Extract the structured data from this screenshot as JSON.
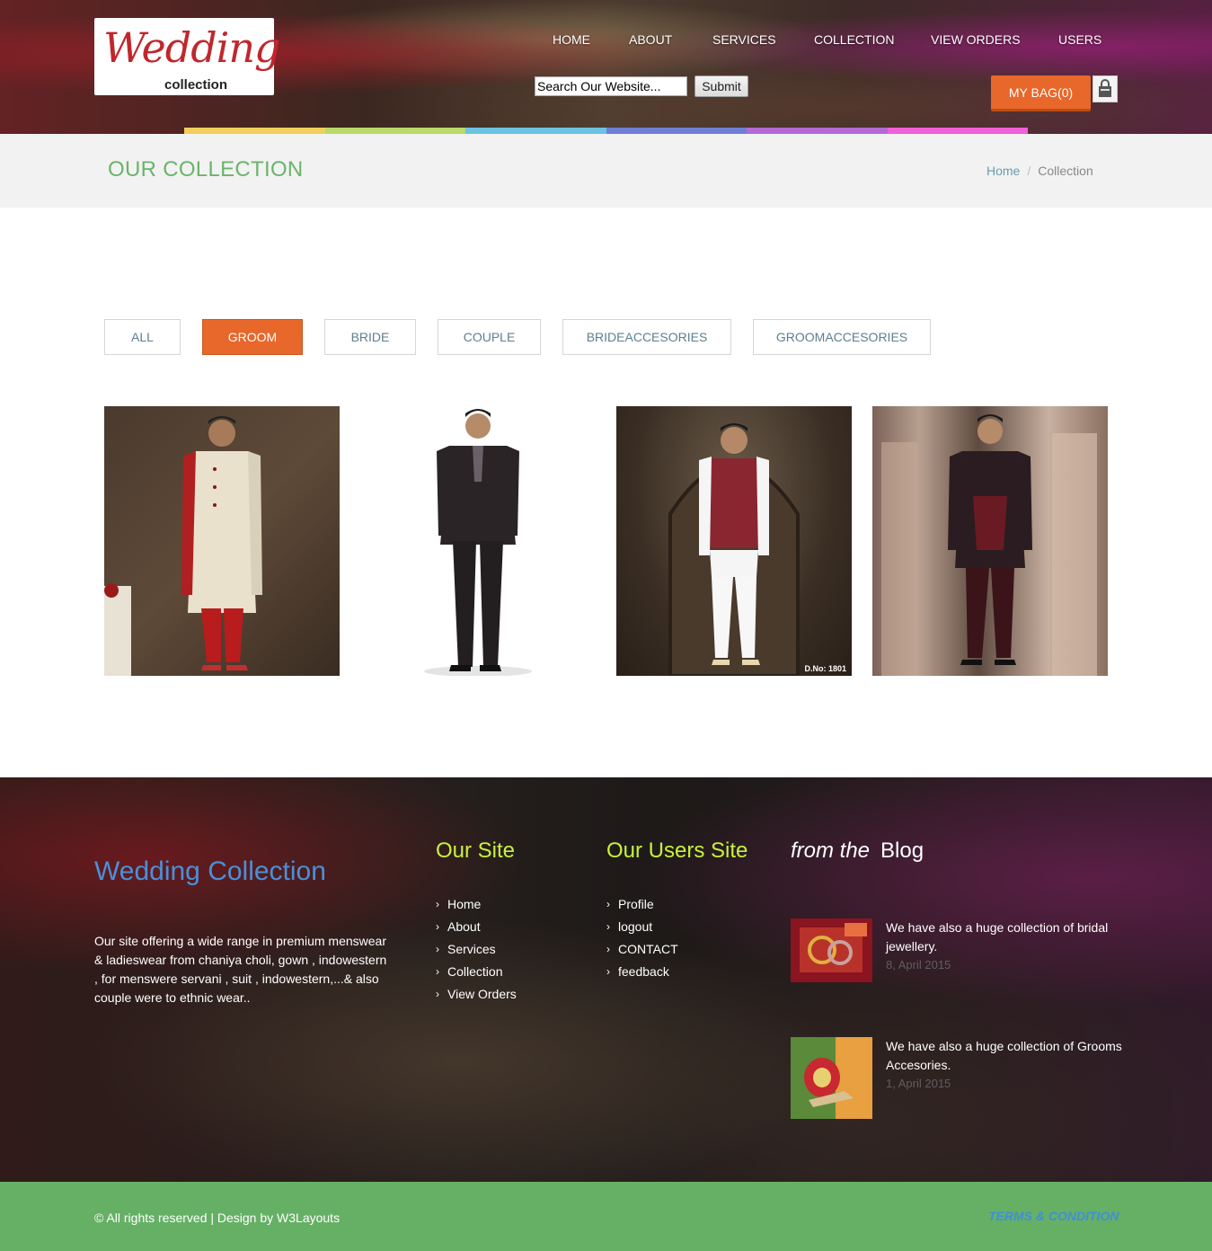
{
  "brand": {
    "logo_script": "Wedding",
    "logo_sub": "collection",
    "colors": {
      "accent": "#e8672a",
      "green": "#6ab46b",
      "lime": "#c7f23a",
      "blue": "#4a90d9"
    }
  },
  "nav": {
    "items": [
      {
        "label": "HOME"
      },
      {
        "label": "ABOUT"
      },
      {
        "label": "SERVICES"
      },
      {
        "label": "COLLECTION"
      },
      {
        "label": "VIEW ORDERS"
      },
      {
        "label": "USERS"
      }
    ]
  },
  "search": {
    "value": "Search Our Website...",
    "button": "Submit"
  },
  "bag": {
    "label": "MY BAG(0)",
    "icon": "bag-icon"
  },
  "color_bar": [
    "#f0cf5b",
    "#b9d96a",
    "#6cc3e1",
    "#6f7fd6",
    "#b36ad6",
    "#f060d8"
  ],
  "page": {
    "title": "OUR COLLECTION",
    "breadcrumb": {
      "home": "Home",
      "separator": "/",
      "current": "Collection"
    }
  },
  "filters": [
    {
      "label": "ALL",
      "active": false
    },
    {
      "label": "GROOM",
      "active": true
    },
    {
      "label": "BRIDE",
      "active": false
    },
    {
      "label": "COUPLE",
      "active": false
    },
    {
      "label": "BRIDEACCESORIES",
      "active": false
    },
    {
      "label": "GROOMACCESORIES",
      "active": false
    }
  ],
  "products": [
    {
      "name": "groom-sherwani-cream"
    },
    {
      "name": "groom-suit-black"
    },
    {
      "name": "groom-maroon-jacket",
      "caption": "D.No: 1801"
    },
    {
      "name": "groom-black-sherwani"
    }
  ],
  "footer": {
    "brand": "Wedding Collection",
    "about": "Our site offering a wide range in premium menswear & ladieswear from chaniya choli, gown , indowestern , for menswere servani , suit , indowestern,...& also couple were to ethnic wear..",
    "our_site": {
      "heading": "Our Site",
      "links": [
        "Home",
        "About",
        "Services",
        "Collection",
        "View Orders"
      ]
    },
    "users_site": {
      "heading": "Our Users Site",
      "links": [
        "Profile",
        "logout",
        "CONTACT",
        "feedback"
      ]
    },
    "blog": {
      "heading_em": "from the",
      "heading": "Blog",
      "posts": [
        {
          "text": "We have also a huge collection of bridal jewellery.",
          "date": "8, April 2015"
        },
        {
          "text": "We have also a huge collection of Grooms Accesories.",
          "date": "1, April 2015"
        }
      ]
    }
  },
  "copyright": {
    "text": "© All rights reserved | Design by W3Layouts",
    "terms": "TERMS & CONDITION"
  }
}
